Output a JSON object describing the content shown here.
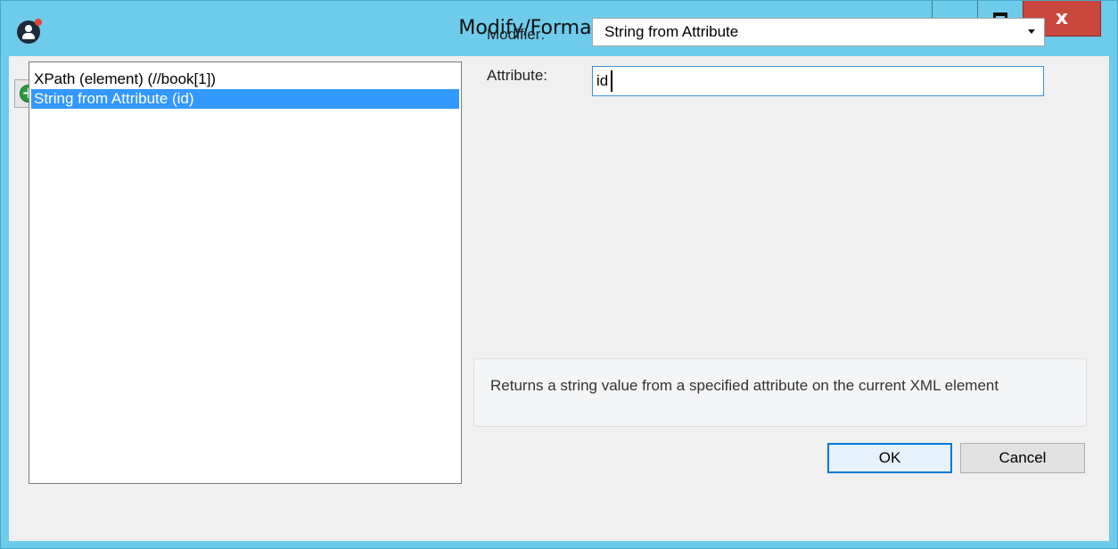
{
  "window": {
    "title": "Modify/Format Value",
    "app_icon": "user-circle-icon",
    "controls": {
      "minimize": "minimize-icon",
      "maximize": "maximize-icon",
      "close_label": "x"
    },
    "colors": {
      "titlebar": "#6ecbe9",
      "close": "#c9473d",
      "selection": "#3399ff"
    }
  },
  "toolbar": {
    "add": "add-icon",
    "delete": "delete-icon",
    "move_up": "arrow-up-icon",
    "move_down": "arrow-down-icon"
  },
  "modifier_list": {
    "items": [
      {
        "label": "XPath (element) (//book[1])",
        "selected": false
      },
      {
        "label": "String from Attribute (id)",
        "selected": true
      }
    ]
  },
  "form": {
    "modifier_label": "Modifier:",
    "modifier_value": "String from Attribute",
    "attribute_label": "Attribute:",
    "attribute_value": "id"
  },
  "description": "Returns a string value from a specified attribute on the current XML element",
  "buttons": {
    "ok": "OK",
    "cancel": "Cancel"
  }
}
